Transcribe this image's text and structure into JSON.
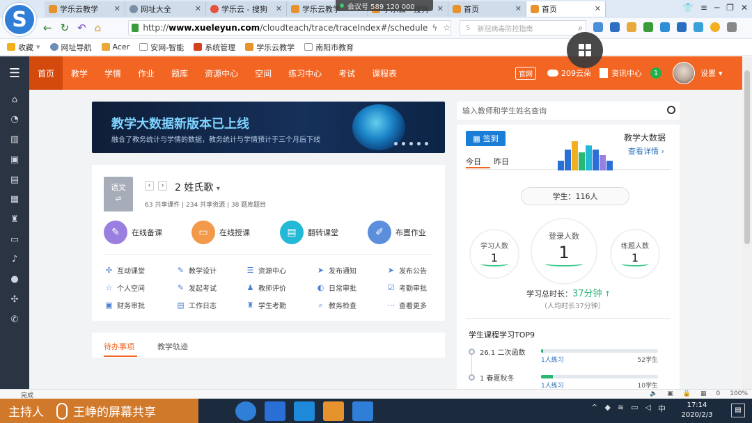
{
  "browser": {
    "tabs": [
      {
        "label": "学乐云教学",
        "icon": "orange"
      },
      {
        "label": "网址大全",
        "icon": "globe"
      },
      {
        "label": "学乐云 - 搜狗",
        "icon": "sogou"
      },
      {
        "label": "学乐云教学",
        "icon": "orange"
      },
      {
        "label": "学乐云 - 搜狗",
        "icon": "orange"
      },
      {
        "label": "首页",
        "icon": "orange"
      },
      {
        "label": "首页",
        "icon": "orange",
        "active": true
      }
    ],
    "meeting_badge": "会议号 589 120 000",
    "url_prefix": "http://",
    "url_domain": "www.xueleyun.com",
    "url_path": "/cloudteach/trace/traceIndex#/schedule",
    "search_placeholder": "新冠病毒防控指南",
    "bookmarks": [
      {
        "label": "收藏",
        "color": "#f2b01e"
      },
      {
        "label": "网址导航",
        "color": "#6b8db6"
      },
      {
        "label": "Acer",
        "color": "#e8a93a"
      },
      {
        "label": "安网-智能",
        "color": "#7a7a7a"
      },
      {
        "label": "系统管理",
        "color": "#d2421f"
      },
      {
        "label": "学乐云教学",
        "color": "#e6922d"
      },
      {
        "label": "南阳市教育",
        "color": "#7a7a7a"
      }
    ],
    "status_left": "完成",
    "status_right": [
      "0",
      "100%"
    ]
  },
  "app": {
    "nav": [
      "首页",
      "教学",
      "学情",
      "作业",
      "题库",
      "资源中心",
      "空间",
      "练习中心",
      "考试",
      "课程表"
    ],
    "site_badge": "官网",
    "cloud_text": "209云朵",
    "news_text": "资讯中心",
    "notif_count": "1",
    "settings_label": "设置",
    "banner": {
      "title": "教学大数据新版本已上线",
      "subtitle": "融合了教务统计与学情的数据，教务统计与学情预计于三个月后下线"
    },
    "class_card": {
      "subject": "语文",
      "class_name": "2 姓氏歌",
      "stats": "63 共享课件  |  234 共享资源  |  38 题库题目"
    },
    "quick_actions": [
      {
        "label": "在线备课",
        "color": "#9a7fe0",
        "icon": "book-icon"
      },
      {
        "label": "在线授课",
        "color": "#f2994a",
        "icon": "screen-icon"
      },
      {
        "label": "翻转课堂",
        "color": "#22b8d6",
        "icon": "flip-icon"
      },
      {
        "label": "布置作业",
        "color": "#5b8fdc",
        "icon": "pencil-icon"
      }
    ],
    "grid": [
      [
        "互动课堂",
        "教学设计",
        "资源中心",
        "发布通知",
        "发布公告"
      ],
      [
        "个人空间",
        "发起考试",
        "教师评价",
        "日常审批",
        "考勤审批"
      ],
      [
        "财务审批",
        "工作日志",
        "学生考勤",
        "教务检查",
        "查看更多"
      ]
    ],
    "todo_tabs": [
      "待办事项",
      "教学轨迹"
    ],
    "right": {
      "search_placeholder": "输入教师和学生姓名查询",
      "signin": "签到",
      "day_tabs": [
        "今日",
        "昨日"
      ],
      "bigdata_title": "教学大数据",
      "bigdata_link": "查看详情",
      "students": "学生：116人",
      "rings": [
        {
          "label": "学习人数",
          "value": "1"
        },
        {
          "label": "登录人数",
          "value": "1"
        },
        {
          "label": "练题人数",
          "value": "1"
        }
      ],
      "study_time_label": "学习总时长：",
      "study_time_value": "37分钟",
      "study_avg": "（人均时长37分钟）",
      "top9_title": "学生课程学习TOP9",
      "top9": [
        {
          "name": "26.1 二次函数",
          "practice": "1人练习",
          "students": "52学生",
          "progress": 0.02
        },
        {
          "name": "1 春夏秋冬",
          "practice": "1人练习",
          "students": "10学生",
          "progress": 0.1
        }
      ]
    }
  },
  "screen_share": {
    "presenter_label": "主持人",
    "share_text": "王峥的屏幕共享"
  },
  "taskbar": {
    "time": "17:14",
    "date": "2020/2/3"
  }
}
